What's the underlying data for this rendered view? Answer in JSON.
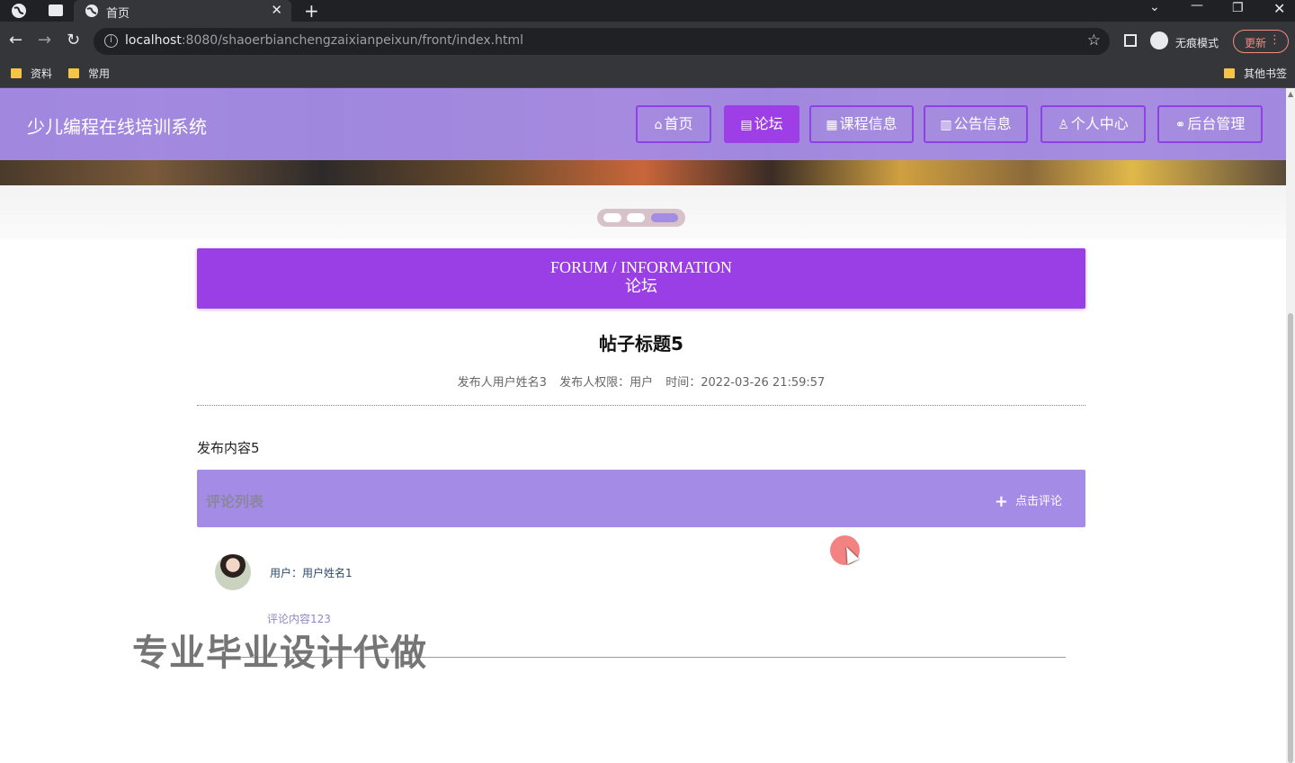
{
  "browser": {
    "tab_title": "首页",
    "url_host": "localhost",
    "url_path": ":8080/shaoerbianchengzaixianpeixun/front/index.html",
    "incognito_label": "无痕模式",
    "update_label": "更新",
    "bookmarks": [
      "资料",
      "常用"
    ],
    "other_bookmarks": "其他书签"
  },
  "site": {
    "logo": "少儿编程在线培训系统",
    "nav": [
      {
        "icon": "⌂",
        "label": "首页"
      },
      {
        "icon": "▤",
        "label": "论坛"
      },
      {
        "icon": "▦",
        "label": "课程信息"
      },
      {
        "icon": "▥",
        "label": "公告信息"
      },
      {
        "icon": "♙",
        "label": "个人中心"
      },
      {
        "icon": "⚭",
        "label": "后台管理"
      }
    ],
    "active_nav": "论坛"
  },
  "forum_banner": {
    "en": "FORUM / INFORMATION",
    "cn": "论坛"
  },
  "post": {
    "title": "帖子标题5",
    "author": "发布人用户姓名3",
    "role": "发布人权限：用户",
    "time": "时间：2022-03-26 21:59:57",
    "content": "发布内容5"
  },
  "comments": {
    "header": "评论列表",
    "add_label": "点击评论",
    "items": [
      {
        "user": "用户：用户姓名1",
        "content": "评论内容123"
      }
    ]
  },
  "watermark": "专业毕业设计代做",
  "colors": {
    "header_purple": "#a48be6",
    "accent_purple": "#9a3ee6"
  }
}
